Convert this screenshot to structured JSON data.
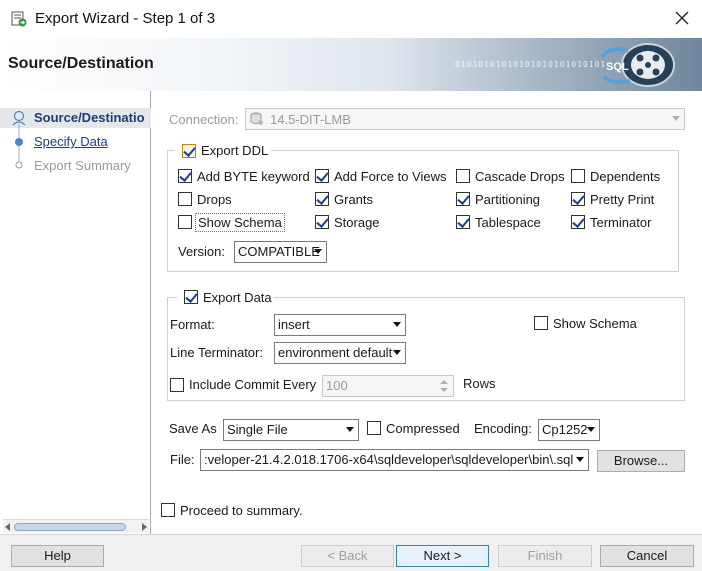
{
  "window": {
    "title": "Export Wizard - Step 1 of 3",
    "close_icon": "close-icon"
  },
  "banner": {
    "heading": "Source/Destination",
    "decor_bits": "01010101010101010101010101",
    "logo_text": "SQL"
  },
  "nav": {
    "items": [
      {
        "label": "Source/Destinatio",
        "state": "active"
      },
      {
        "label": "Specify Data",
        "state": "link"
      },
      {
        "label": "Export Summary",
        "state": "disabled"
      }
    ]
  },
  "connection": {
    "label": "Connection:",
    "value": "14.5-DIT-LMB"
  },
  "export_ddl": {
    "label": "Export DDL",
    "checked": true,
    "options": [
      {
        "label": "Add BYTE keyword",
        "checked": true
      },
      {
        "label": "Add Force to Views",
        "checked": true
      },
      {
        "label": "Cascade Drops",
        "checked": false
      },
      {
        "label": "Dependents",
        "checked": false
      },
      {
        "label": "Drops",
        "checked": false
      },
      {
        "label": "Grants",
        "checked": true
      },
      {
        "label": "Partitioning",
        "checked": true
      },
      {
        "label": "Pretty Print",
        "checked": true
      },
      {
        "label": "Show Schema",
        "checked": false
      },
      {
        "label": "Storage",
        "checked": true
      },
      {
        "label": "Tablespace",
        "checked": true
      },
      {
        "label": "Terminator",
        "checked": true
      }
    ],
    "version_label": "Version:",
    "version_value": "COMPATIBLE"
  },
  "export_data": {
    "label": "Export Data",
    "checked": true,
    "format_label": "Format:",
    "format_value": "insert",
    "show_schema_label": "Show Schema",
    "line_terminator_label": "Line Terminator:",
    "line_terminator_value": "environment default",
    "include_commit_label": "Include Commit Every",
    "commit_value": "100",
    "rows_label": "Rows"
  },
  "save": {
    "save_as_label": "Save As",
    "save_as_value": "Single File",
    "compressed_label": "Compressed",
    "encoding_label": "Encoding:",
    "encoding_value": "Cp1252",
    "file_label": "File:",
    "file_value": ":veloper-21.4.2.018.1706-x64\\sqldeveloper\\sqldeveloper\\bin\\.sql",
    "browse_label": "Browse..."
  },
  "proceed_label": "Proceed to summary.",
  "footer": {
    "help": "Help",
    "back": "< Back",
    "next": "Next >",
    "finish": "Finish",
    "cancel": "Cancel"
  },
  "colors": {
    "accent": "#1c3f86",
    "checkbox_orange": "#c87a16",
    "nav_active": "#1b3e73"
  }
}
